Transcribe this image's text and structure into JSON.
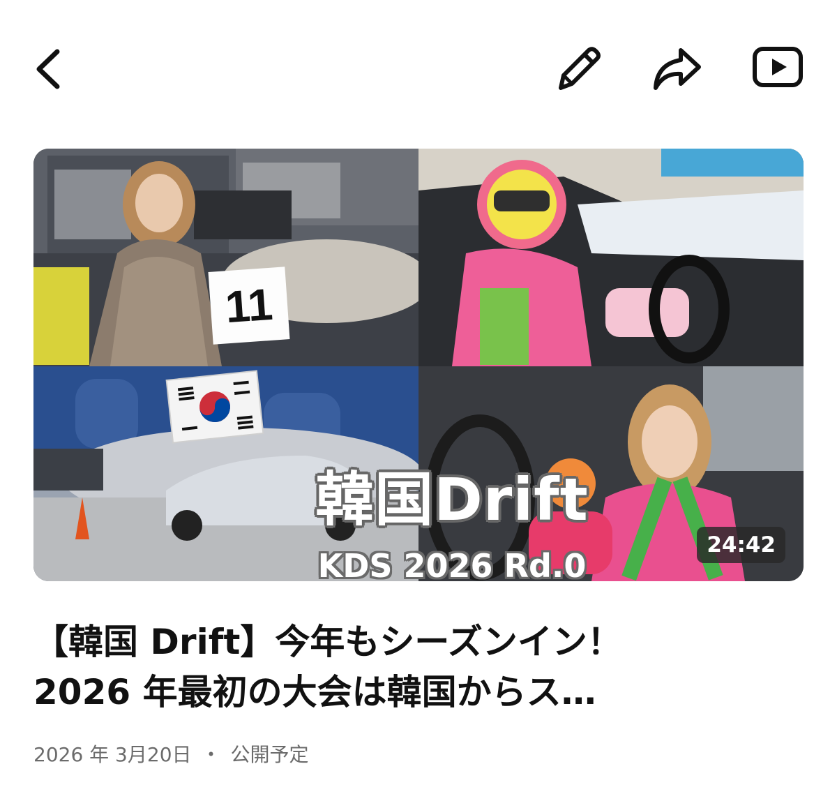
{
  "toolbar": {
    "back_icon": "chevron-left-icon",
    "edit_icon": "pencil-icon",
    "share_icon": "share-arrow-icon",
    "youtube_icon": "youtube-play-icon"
  },
  "thumbnail": {
    "overlay_title": "韓国Drift",
    "overlay_subtitle": "KDS 2026 Rd.0",
    "race_number": "11",
    "duration": "24:42"
  },
  "video": {
    "title_line1": "【韓国 Drift】今年もシーズンイン！",
    "title_line2": "2026 年最初の大会は韓国からス…",
    "date": "2026 年 3月20日",
    "separator": "・",
    "status": "公開予定"
  },
  "colors": {
    "text": "#111111",
    "meta": "#6b6b6b",
    "duration_bg": "#282828"
  }
}
